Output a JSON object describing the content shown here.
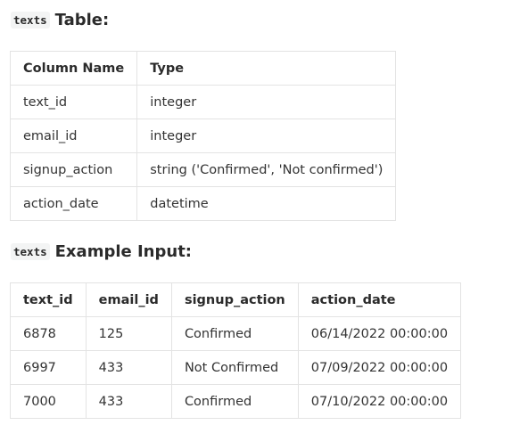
{
  "schema_section": {
    "code": "texts",
    "title": "Table:",
    "columns": [
      "Column Name",
      "Type"
    ],
    "rows": [
      [
        "text_id",
        "integer"
      ],
      [
        "email_id",
        "integer"
      ],
      [
        "signup_action",
        "string ('Confirmed', 'Not confirmed')"
      ],
      [
        "action_date",
        "datetime"
      ]
    ]
  },
  "example_section": {
    "code": "texts",
    "title": "Example Input:",
    "columns": [
      "text_id",
      "email_id",
      "signup_action",
      "action_date"
    ],
    "rows": [
      [
        "6878",
        "125",
        "Confirmed",
        "06/14/2022 00:00:00"
      ],
      [
        "6997",
        "433",
        "Not Confirmed",
        "07/09/2022 00:00:00"
      ],
      [
        "7000",
        "433",
        "Confirmed",
        "07/10/2022 00:00:00"
      ]
    ]
  }
}
